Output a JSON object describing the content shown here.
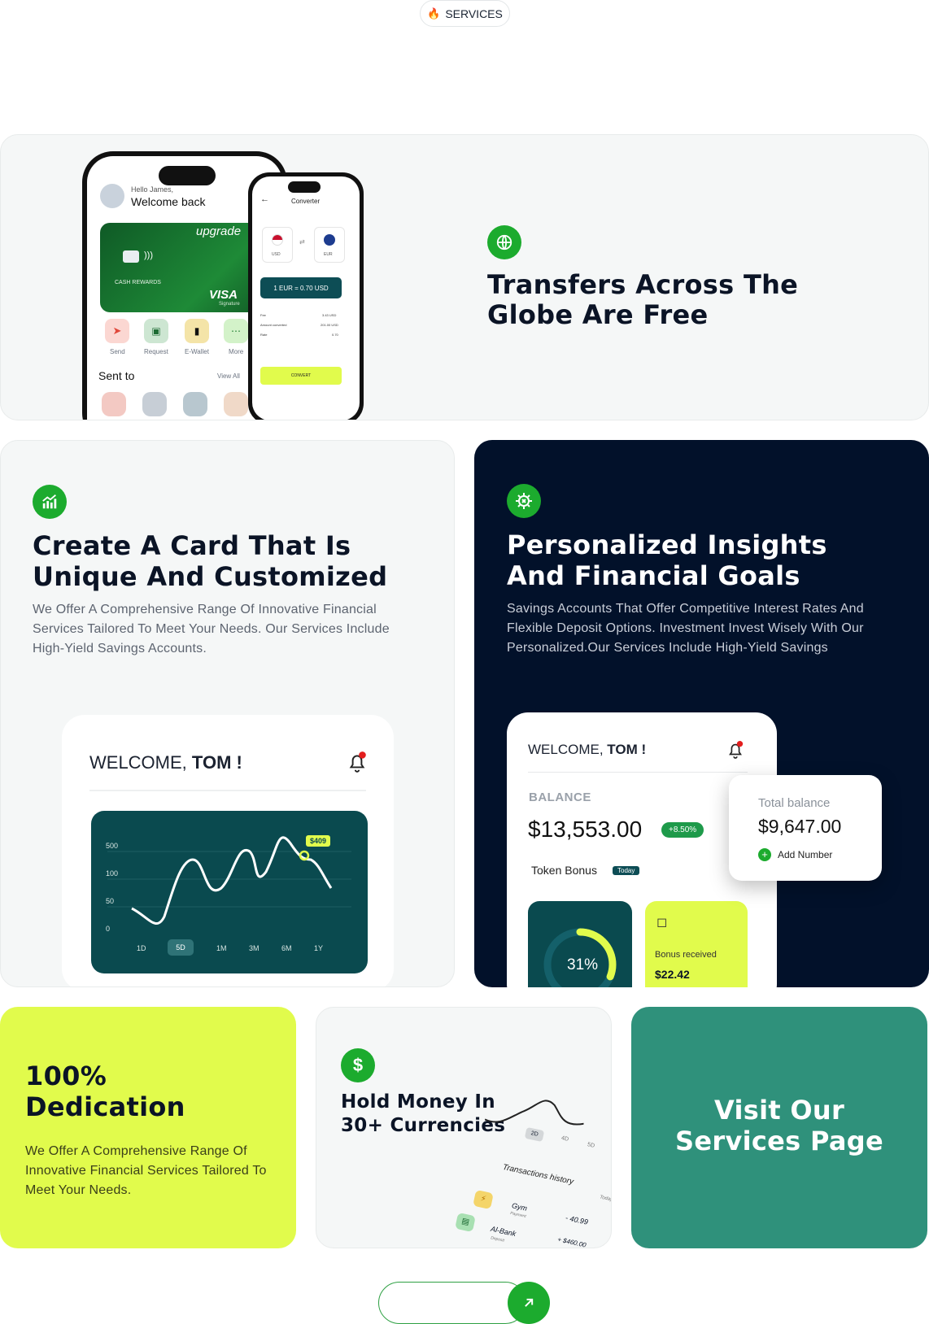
{
  "badge": {
    "label": "SERVICES",
    "icon": "flame-icon"
  },
  "transfers": {
    "title_line1": "Transfers Across The",
    "title_line2": "Globe Are Free",
    "icon": "globe-icon",
    "phone_main": {
      "greeting": "Hello James,",
      "welcome": "Welcome back",
      "card_brand": "upgrade",
      "card_label": "CASH REWARDS",
      "card_network": "VISA",
      "card_network_sub": "Signature",
      "actions": [
        "Send",
        "Request",
        "E-Wallet",
        "More"
      ],
      "sent_to": "Sent to",
      "view_all": "View All"
    },
    "phone_converter": {
      "title": "Converter",
      "from_currency": "USD",
      "to_currency": "EUR",
      "rate_text": "1 EUR  =  0.70 USD",
      "rows": [
        {
          "label": "Fee",
          "value": "3.43 USD"
        },
        {
          "label": "Amount converted",
          "value": "201.00 USD"
        },
        {
          "label": "Rate",
          "value": "0.70"
        }
      ],
      "button": "CONVERT"
    }
  },
  "create_card": {
    "icon": "chart-growth-icon",
    "title_line1": "Create A Card That Is",
    "title_line2": "Unique And Customized",
    "description": "We Offer A Comprehensive Range Of Innovative Financial Services Tailored To Meet Your Needs. Our Services Include High-Yield Savings Accounts.",
    "widget": {
      "welcome_prefix": "WELCOME,",
      "welcome_name": "TOM !",
      "tooltip": "$409",
      "y_ticks": [
        "500",
        "100",
        "50",
        "0"
      ],
      "ranges": [
        "1D",
        "5D",
        "1M",
        "3M",
        "6M",
        "1Y"
      ],
      "selected_range": "5D"
    }
  },
  "insights": {
    "icon": "gear-dollar-icon",
    "title_line1": "Personalized Insights",
    "title_line2": "And Financial Goals",
    "description": "Savings Accounts That Offer Competitive Interest Rates And Flexible Deposit Options. Investment Invest Wisely With Our Personalized.Our Services Include High-Yield Savings",
    "widget": {
      "welcome_prefix": "WELCOME,",
      "welcome_name": "TOM !",
      "balance_label": "BALANCE",
      "balance_value": "$13,553.00",
      "change": "+8.50%",
      "token_bonus": "Token Bonus",
      "today": "Today",
      "progress": "31%",
      "bonus_label": "Bonus received",
      "bonus_value": "$22.42",
      "total_label": "Total balance",
      "total_value": "$9,647.00",
      "add_number": "Add Number"
    }
  },
  "dedication": {
    "title_line1": "100%",
    "title_line2": "Dedication",
    "description": "We Offer A Comprehensive Range Of Innovative Financial Services Tailored To Meet Your Needs."
  },
  "currencies": {
    "icon": "dollar-icon",
    "title_line1": "Hold Money In",
    "title_line2": "30+ Currencies",
    "ranges": [
      "2D",
      "4D",
      "5D"
    ],
    "history_title": "Transactions history",
    "history_today": "Today",
    "transactions": [
      {
        "name": "Gym",
        "sub": "Payment",
        "amount": "- 40.99"
      },
      {
        "name": "Al-Bank",
        "sub": "Deposit",
        "amount": "+ $460.00"
      }
    ]
  },
  "visit": {
    "line1": "Visit Our",
    "line2": "Services Page"
  },
  "colors": {
    "green": "#1cab2e",
    "lime": "#e1fb4c",
    "navy": "#02112a",
    "teal": "#2f917b",
    "chart_bg": "#0a4a4f"
  }
}
